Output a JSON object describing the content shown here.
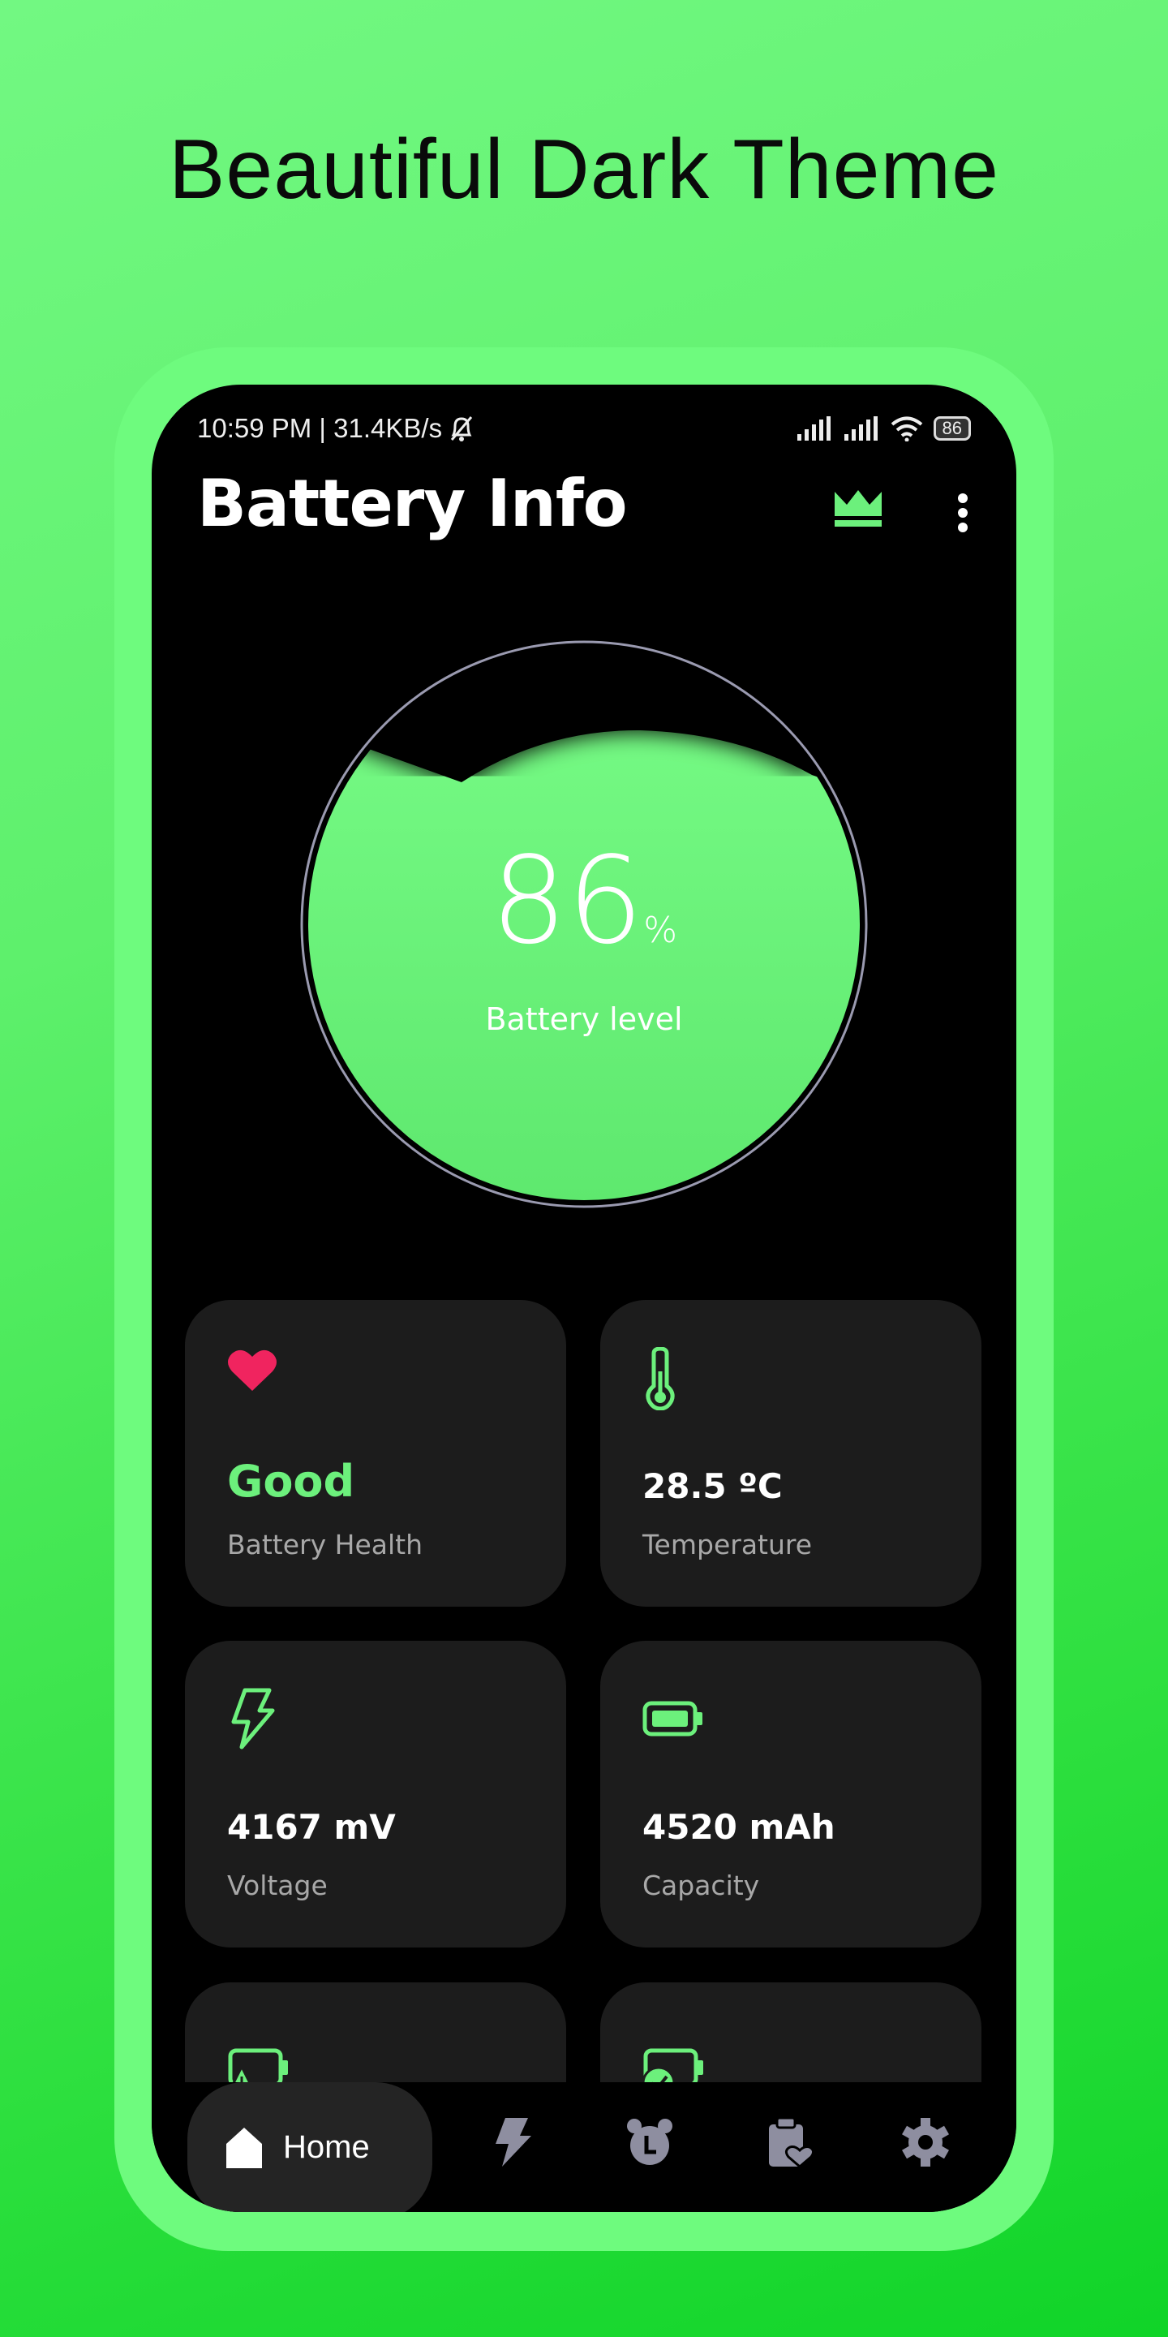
{
  "headline": "Beautiful Dark Theme",
  "status": {
    "time": "10:59 PM | 31.4KB/s",
    "battery": "86"
  },
  "app": {
    "title": "Battery Info"
  },
  "gauge": {
    "value": "86",
    "unit": "%",
    "label": "Battery level",
    "level_fraction": 0.86
  },
  "cards": [
    {
      "value": "Good",
      "label": "Battery Health",
      "icon": "heart-icon"
    },
    {
      "value": "28.5 ºC",
      "label": "Temperature",
      "icon": "thermometer-icon"
    },
    {
      "value": "4167 mV",
      "label": "Voltage",
      "icon": "lightning-icon"
    },
    {
      "value": "4520 mAh",
      "label": "Capacity",
      "icon": "battery-icon"
    },
    {
      "value": "",
      "label": "",
      "icon": "battery-warning-icon"
    },
    {
      "value": "",
      "label": "",
      "icon": "battery-check-icon"
    }
  ],
  "nav": {
    "active": "Home",
    "items": [
      "home",
      "charging",
      "alarm",
      "clipboard-health",
      "settings"
    ]
  },
  "colors": {
    "accent": "#6cf07c",
    "heart": "#f0245f",
    "card": "#1c1c1c",
    "nav_icon": "#8e8ea0"
  }
}
